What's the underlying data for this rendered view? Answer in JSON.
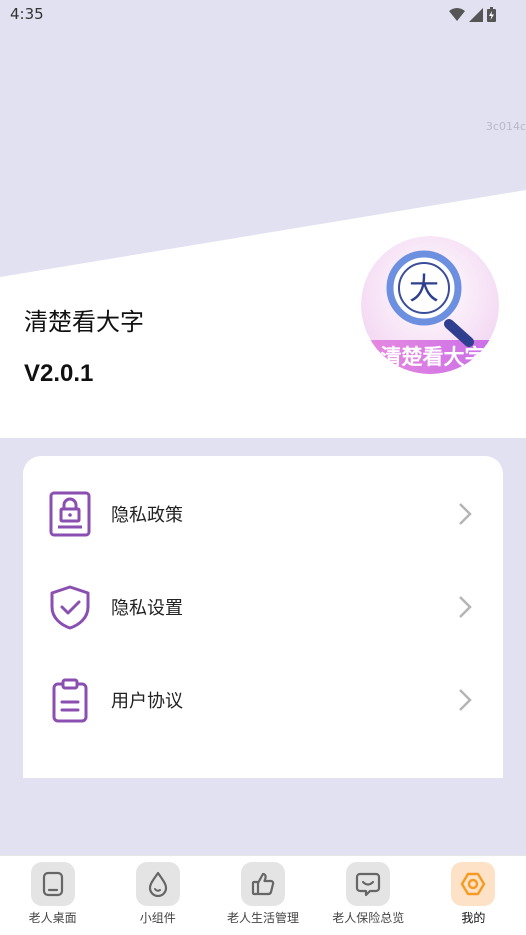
{
  "status_bar": {
    "time": "4:35"
  },
  "watermark": "3c014c",
  "app": {
    "name": "清楚看大字",
    "version": "V2.0.1",
    "logo_char": "大",
    "logo_text": "清楚看大字"
  },
  "menu": [
    {
      "label": "隐私政策",
      "icon": "privacy-document-lock-icon"
    },
    {
      "label": "隐私设置",
      "icon": "shield-check-icon"
    },
    {
      "label": "用户协议",
      "icon": "clipboard-icon"
    }
  ],
  "bottom_nav": [
    {
      "label": "老人桌面",
      "icon": "tablet-icon",
      "active": false
    },
    {
      "label": "小组件",
      "icon": "droplet-icon",
      "active": false
    },
    {
      "label": "老人生活管理",
      "icon": "thumbs-up-icon",
      "active": false
    },
    {
      "label": "老人保险总览",
      "icon": "chat-smile-icon",
      "active": false
    },
    {
      "label": "我的",
      "icon": "hexagon-icon",
      "active": true
    }
  ],
  "colors": {
    "accent_purple": "#8a4fb0",
    "accent_orange": "#f59a23",
    "background": "#e1e1f2"
  }
}
